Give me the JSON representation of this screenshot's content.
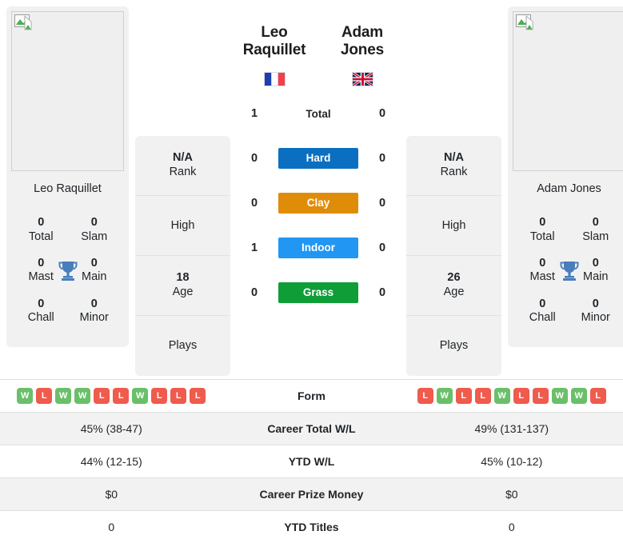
{
  "colors": {
    "hard": "#0b6fc1",
    "clay": "#df8d09",
    "indoor": "#2196f3",
    "grass": "#0f9d38",
    "win": "#6abf69",
    "loss": "#ef5b4c",
    "trophy": "#4a7ebb",
    "card_bg": "#f1f1f1"
  },
  "left_player": {
    "name": "Leo Raquillet",
    "photo_caption": "Leo Raquillet",
    "photo_alt_icon": "broken-image-icon",
    "flag": "fr-flag-icon",
    "flag_name": "France",
    "titles": [
      {
        "num": "0",
        "label": "Total"
      },
      {
        "num": "0",
        "label": "Slam"
      },
      {
        "num": "0",
        "label": "Mast"
      },
      {
        "num": "0",
        "label": "Main"
      },
      {
        "num": "0",
        "label": "Chall"
      },
      {
        "num": "0",
        "label": "Minor"
      }
    ],
    "info": [
      {
        "value": "N/A",
        "label": "Rank"
      },
      {
        "value": "",
        "label": "High"
      },
      {
        "value": "18",
        "label": "Age"
      },
      {
        "value": "",
        "label": "Plays"
      }
    ],
    "form": [
      "W",
      "L",
      "W",
      "W",
      "L",
      "L",
      "W",
      "L",
      "L",
      "L"
    ],
    "career_total_wl": "45% (38-47)",
    "ytd_wl": "44% (12-15)",
    "career_prize_money": "$0",
    "ytd_titles": "0"
  },
  "right_player": {
    "name": "Adam Jones",
    "photo_caption": "Adam Jones",
    "photo_alt_icon": "broken-image-icon",
    "flag": "gb-flag-icon",
    "flag_name": "Great Britain",
    "titles": [
      {
        "num": "0",
        "label": "Total"
      },
      {
        "num": "0",
        "label": "Slam"
      },
      {
        "num": "0",
        "label": "Mast"
      },
      {
        "num": "0",
        "label": "Main"
      },
      {
        "num": "0",
        "label": "Chall"
      },
      {
        "num": "0",
        "label": "Minor"
      }
    ],
    "info": [
      {
        "value": "N/A",
        "label": "Rank"
      },
      {
        "value": "",
        "label": "High"
      },
      {
        "value": "26",
        "label": "Age"
      },
      {
        "value": "",
        "label": "Plays"
      }
    ],
    "form": [
      "L",
      "W",
      "L",
      "L",
      "W",
      "L",
      "L",
      "W",
      "W",
      "L"
    ],
    "career_total_wl": "49% (131-137)",
    "ytd_wl": "45% (10-12)",
    "career_prize_money": "$0",
    "ytd_titles": "0"
  },
  "h2h": [
    {
      "label": "Total",
      "left": "1",
      "right": "0",
      "style": "plain"
    },
    {
      "label": "Hard",
      "left": "0",
      "right": "0",
      "style": "badge",
      "color": "#0b6fc1"
    },
    {
      "label": "Clay",
      "left": "0",
      "right": "0",
      "style": "badge",
      "color": "#df8d09"
    },
    {
      "label": "Indoor",
      "left": "1",
      "right": "0",
      "style": "badge",
      "color": "#2196f3"
    },
    {
      "label": "Grass",
      "left": "0",
      "right": "0",
      "style": "badge",
      "color": "#0f9d38"
    }
  ],
  "stat_rows": [
    {
      "label": "Form",
      "type": "form"
    },
    {
      "label": "Career Total W/L",
      "type": "text",
      "left": "45% (38-47)",
      "right": "49% (131-137)"
    },
    {
      "label": "YTD W/L",
      "type": "text",
      "left": "44% (12-15)",
      "right": "45% (10-12)"
    },
    {
      "label": "Career Prize Money",
      "type": "text",
      "left": "$0",
      "right": "$0"
    },
    {
      "label": "YTD Titles",
      "type": "text",
      "left": "0",
      "right": "0"
    }
  ]
}
